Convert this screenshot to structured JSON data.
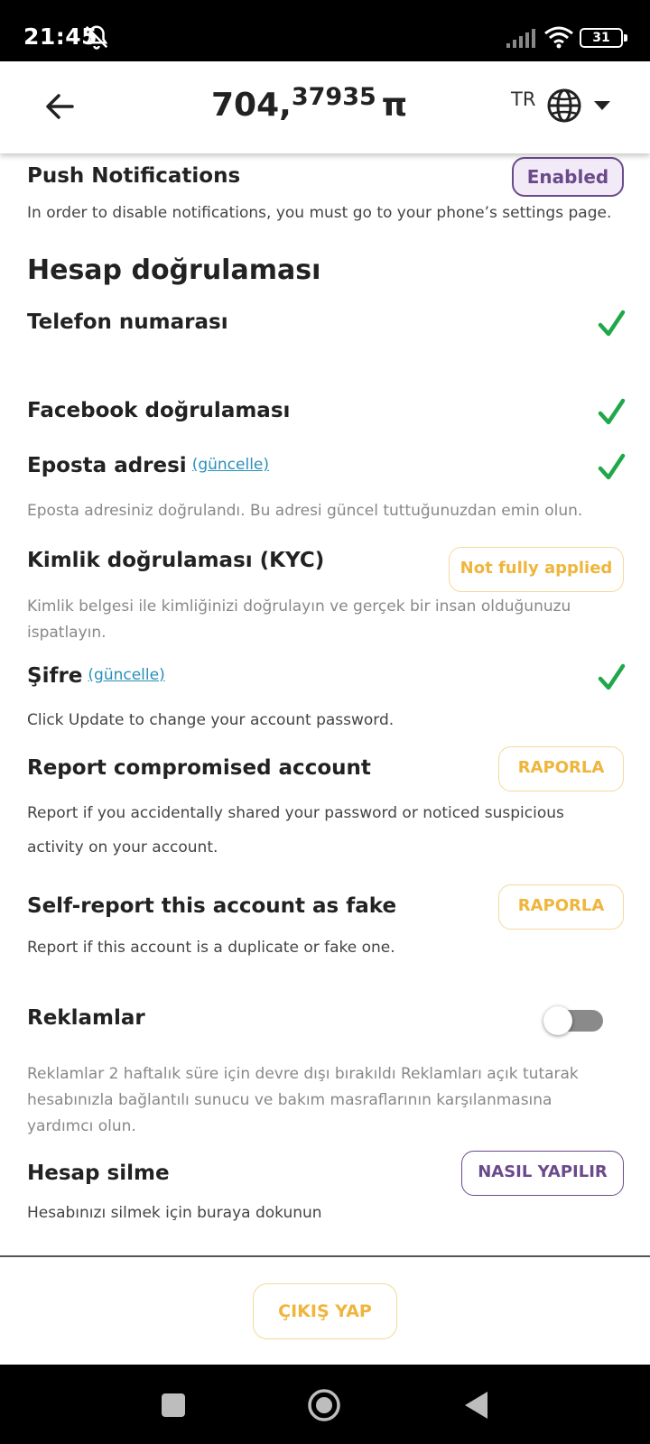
{
  "status_bar": {
    "time": "21:45",
    "battery": "31",
    "icons": [
      "bell-off-icon",
      "signal-icon",
      "wifi-icon",
      "battery-icon"
    ]
  },
  "header": {
    "balance_int": "704,",
    "balance_dec": "37935",
    "currency": "π",
    "language": "TR",
    "icons": [
      "arrow-left-icon",
      "globe-icon",
      "caret-down-icon"
    ]
  },
  "push": {
    "title": "Push Notifications",
    "status": "Enabled",
    "desc": "In order to disable notifications, you must go to your phone’s settings page."
  },
  "verification": {
    "section_title": "Hesap doğrulaması",
    "phone_label": "Telefon numarası",
    "facebook_label": "Facebook doğrulaması",
    "email_label": "Eposta adresi",
    "email_link": "(güncelle)",
    "email_desc": "Eposta adresiniz doğrulandı. Bu adresi güncel tuttuğunuzdan emin olun.",
    "kyc_label": "Kimlik doğrulaması (KYC)",
    "kyc_status": "Not fully applied",
    "kyc_desc_1": "Kimlik belgesi ile kimliğinizi doğrulayın ve gerçek bir insan olduğunuzu",
    "kyc_desc_2": "ispatlayın.",
    "password_label": "Şifre",
    "password_link": "(güncelle)",
    "password_desc": "Click Update to change your account password."
  },
  "report": {
    "compromised_title": "Report compromised account",
    "compromised_button": "RAPORLA",
    "compromised_desc_1": "Report if you accidentally shared your password or noticed suspicious",
    "compromised_desc_2": "activity on your account.",
    "fake_title": "Self-report this account as fake",
    "fake_button": "RAPORLA",
    "fake_desc": "Report if this account is a duplicate or fake one."
  },
  "ads": {
    "title": "Reklamlar",
    "toggle_on": false,
    "desc_1": "Reklamlar 2 haftalık süre için devre dışı bırakıldı Reklamları açık tutarak",
    "desc_2": "hesabınızla bağlantılı sunucu ve bakım masraflarının karşılanmasına",
    "desc_3": "yardımcı olun."
  },
  "delete": {
    "title": "Hesap silme",
    "button": "NASIL YAPILIR",
    "desc": "Hesabınızı silmek için buraya dokunun"
  },
  "footer": {
    "logout": "ÇIKIŞ YAP"
  },
  "colors": {
    "check_green": "#1fa84a",
    "accent_purple": "#6b4a8b",
    "accent_orange": "#efb53c",
    "link_blue": "#2a8fb8"
  }
}
